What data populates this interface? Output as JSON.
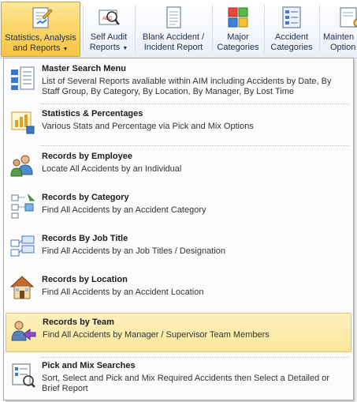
{
  "ribbon": {
    "buttons": [
      {
        "name": "statistics-analysis-reports",
        "line1": "Statistics, Analysis",
        "line2": "and Reports",
        "dropdown": true,
        "active": true
      },
      {
        "name": "self-audit-reports",
        "line1": "Self Audit",
        "line2": "Reports",
        "dropdown": true
      },
      {
        "name": "blank-accident-incident-report",
        "line1": "Blank Accident /",
        "line2": "Incident Report"
      },
      {
        "name": "major-categories",
        "line1": "Major",
        "line2": "Categories"
      },
      {
        "name": "accident-categories",
        "line1": "Accident",
        "line2": "Categories"
      },
      {
        "name": "maintenance-options",
        "line1": "Mainten",
        "line2": "Option"
      }
    ]
  },
  "menu": {
    "items": [
      {
        "title": "Master Search Menu",
        "desc": "List of Several Reports avaliable within AIM including Accidents by Date, By Staff Group, By Category, By Location, By Manager, By Lost Time"
      },
      {
        "title": "Statistics & Percentages",
        "desc": "Various Stats and Percentage via Pick and Mix Options"
      },
      {
        "title": "Records by Employee",
        "desc": "Locate All Accidents by an Individual"
      },
      {
        "title": "Records by Category",
        "desc": "Find All Accidents by an Accident Category"
      },
      {
        "title": "Records By Job Title",
        "desc": "Find All Accidents by an Job Titles / Designation"
      },
      {
        "title": "Records by Location",
        "desc": "Find All Accidents by an Accident Location"
      },
      {
        "title": "Records by Team",
        "desc": "Find All Accidents by Manager / Supervisor Team Members",
        "highlighted": true
      },
      {
        "title": "Pick and Mix Searches",
        "desc": "Sort, Select and Pick and Mix Required Accidents then Select a Detailed or Brief Report"
      }
    ]
  },
  "colors": {
    "active_button": "#fcd66b",
    "highlight_row": "#fde79a",
    "ribbon_text": "#1e2f4d"
  }
}
